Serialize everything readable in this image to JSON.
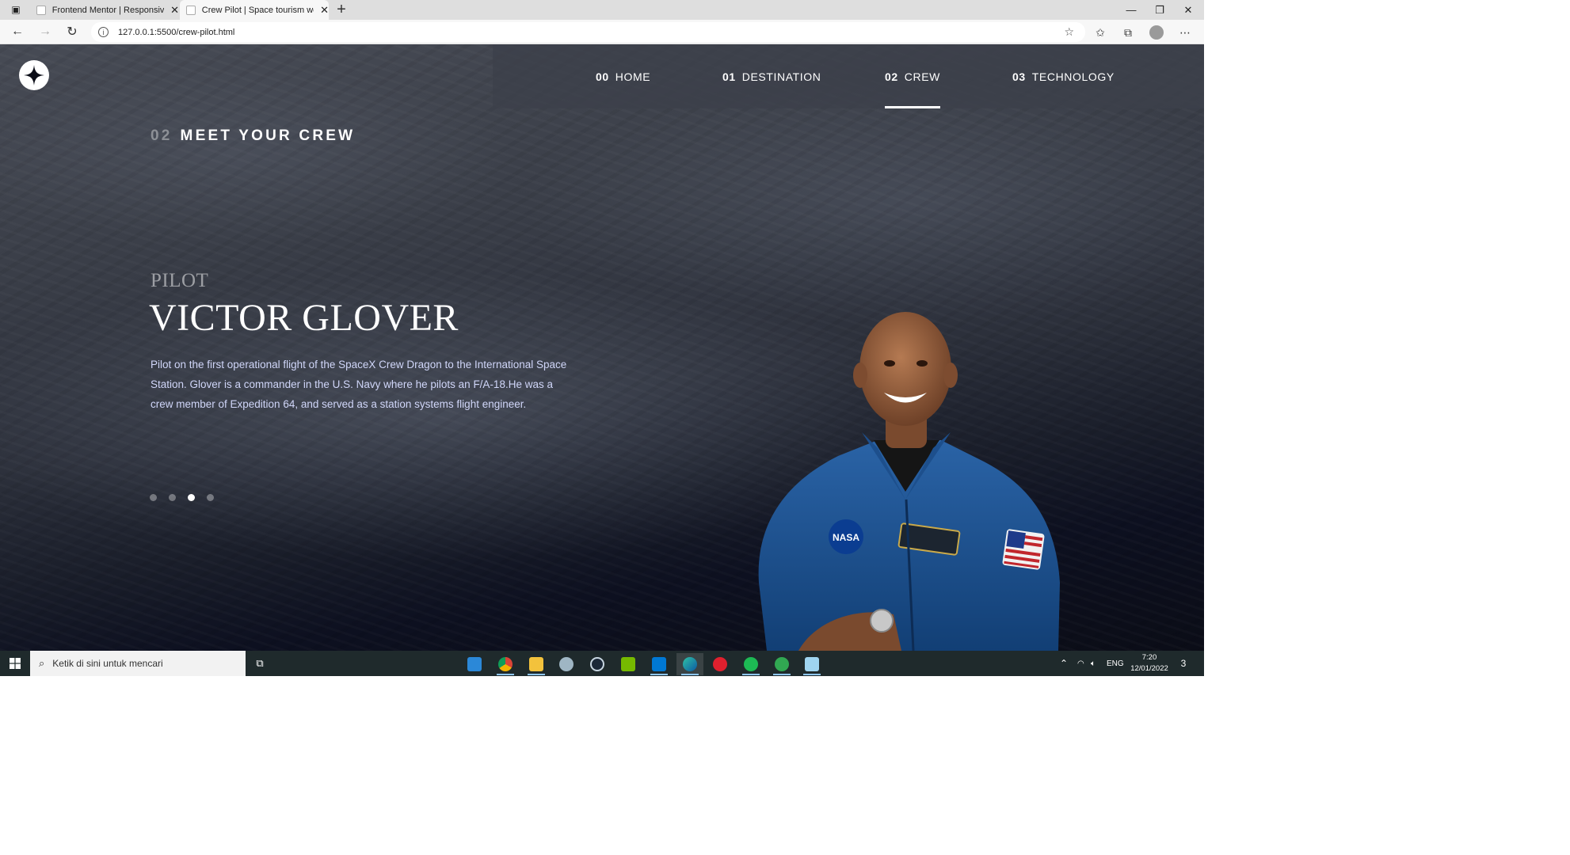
{
  "browser": {
    "tabs": [
      {
        "title": "Frontend Mentor | Responsive C",
        "active": false
      },
      {
        "title": "Crew Pilot | Space tourism websi",
        "active": true
      }
    ],
    "url": "127.0.0.1:5500/crew-pilot.html"
  },
  "site": {
    "nav": [
      {
        "num": "00",
        "label": "HOME"
      },
      {
        "num": "01",
        "label": "DESTINATION"
      },
      {
        "num": "02",
        "label": "CREW",
        "active": true
      },
      {
        "num": "03",
        "label": "TECHNOLOGY"
      }
    ],
    "heading": {
      "num": "02",
      "text": "MEET YOUR CREW"
    },
    "crew": {
      "role": "PILOT",
      "name": "VICTOR GLOVER",
      "bio": "Pilot on the first operational flight of the SpaceX Crew Dragon to the International Space Station. Glover is a commander in the U.S. Navy where he pilots an F/A-18.He was a crew member of Expedition 64, and served as a station systems flight engineer."
    },
    "slider": {
      "count": 4,
      "active_index": 2
    },
    "colors": {
      "background": "#0b0d17",
      "text": "#ffffff",
      "body_text": "#d0d6f9"
    }
  },
  "taskbar": {
    "search_placeholder": "Ketik di sini untuk mencari",
    "language": "ENG",
    "time": "7:20",
    "date": "12/01/2022",
    "notifications": "3"
  }
}
